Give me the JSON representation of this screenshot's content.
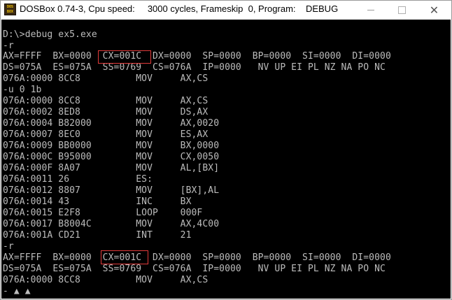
{
  "window": {
    "title": "DOSBox 0.74-3, Cpu speed:     3000 cycles, Frameskip  0, Program:    DEBUG",
    "icon_label_top": "DOS",
    "icon_label_bottom": "BOX",
    "buttons": [
      "minimize-icon",
      "maximize-icon",
      "close-icon"
    ],
    "close_glyph": "✕"
  },
  "console": {
    "lines": [
      "D:\\>debug ex5.exe",
      "-r",
      "AX=FFFF  BX=0000  CX=001C  DX=0000  SP=0000  BP=0000  SI=0000  DI=0000",
      "DS=075A  ES=075A  SS=0769  CS=076A  IP=0000   NV UP EI PL NZ NA PO NC",
      "076A:0000 8CC8          MOV     AX,CS",
      "-u 0 1b",
      "076A:0000 8CC8          MOV     AX,CS",
      "076A:0002 8ED8          MOV     DS,AX",
      "076A:0004 B82000        MOV     AX,0020",
      "076A:0007 8EC0          MOV     ES,AX",
      "076A:0009 BB0000        MOV     BX,0000",
      "076A:000C B95000        MOV     CX,0050",
      "076A:000F 8A07          MOV     AL,[BX]",
      "076A:0011 26            ES:",
      "076A:0012 8807          MOV     [BX],AL",
      "076A:0014 43            INC     BX",
      "076A:0015 E2F8          LOOP    000F",
      "076A:0017 B8004C        MOV     AX,4C00",
      "076A:001A CD21          INT     21",
      "-r",
      "AX=FFFF  BX=0000  CX=001C  DX=0000  SP=0000  BP=0000  SI=0000  DI=0000",
      "DS=075A  ES=075A  SS=0769  CS=076A  IP=0000   NV UP EI PL NZ NA PO NC",
      "076A:0000 8CC8          MOV     AX,CS"
    ],
    "prompt_tail": "- ▲ ▲",
    "highlighted_value": "CX=001C",
    "colors": {
      "background": "#000000",
      "text": "#bcbcbc",
      "highlight_border": "#e23a3a"
    }
  }
}
